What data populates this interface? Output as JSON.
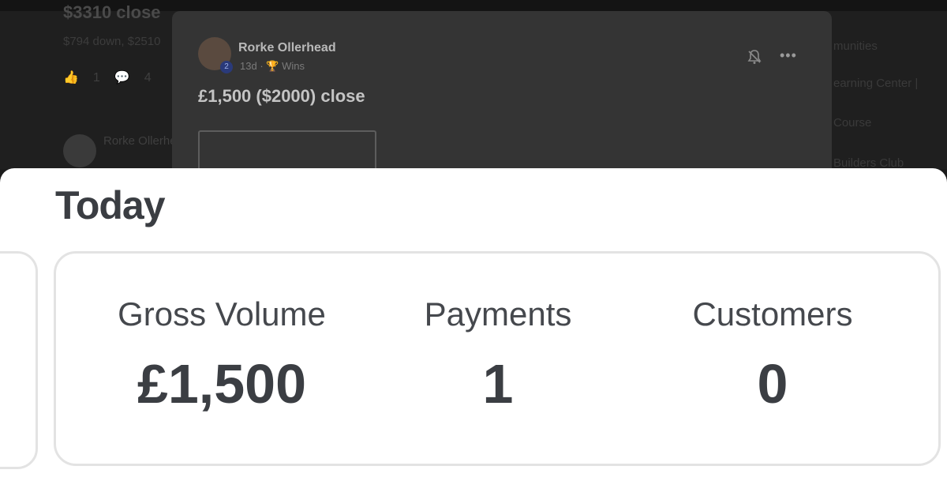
{
  "background": {
    "partial_post_title": "$3310 close",
    "partial_post_subtitle": "$794 down, $2510",
    "post_actions": [
      "👍",
      "1",
      "💬",
      "4"
    ],
    "second_author": "Rorke Ollerhead",
    "sidebar_items": [
      "munities",
      "earning Center |",
      "Course",
      "Builders Club"
    ]
  },
  "modal": {
    "author": "Rorke Ollerhead",
    "level": "2",
    "time": "13d",
    "category": "Wins",
    "post_title": "£1,500 ($2000) close"
  },
  "summary": {
    "heading": "Today",
    "stats": [
      {
        "label": "Gross Volume",
        "value": "£1,500"
      },
      {
        "label": "Payments",
        "value": "1"
      },
      {
        "label": "Customers",
        "value": "0"
      }
    ]
  }
}
